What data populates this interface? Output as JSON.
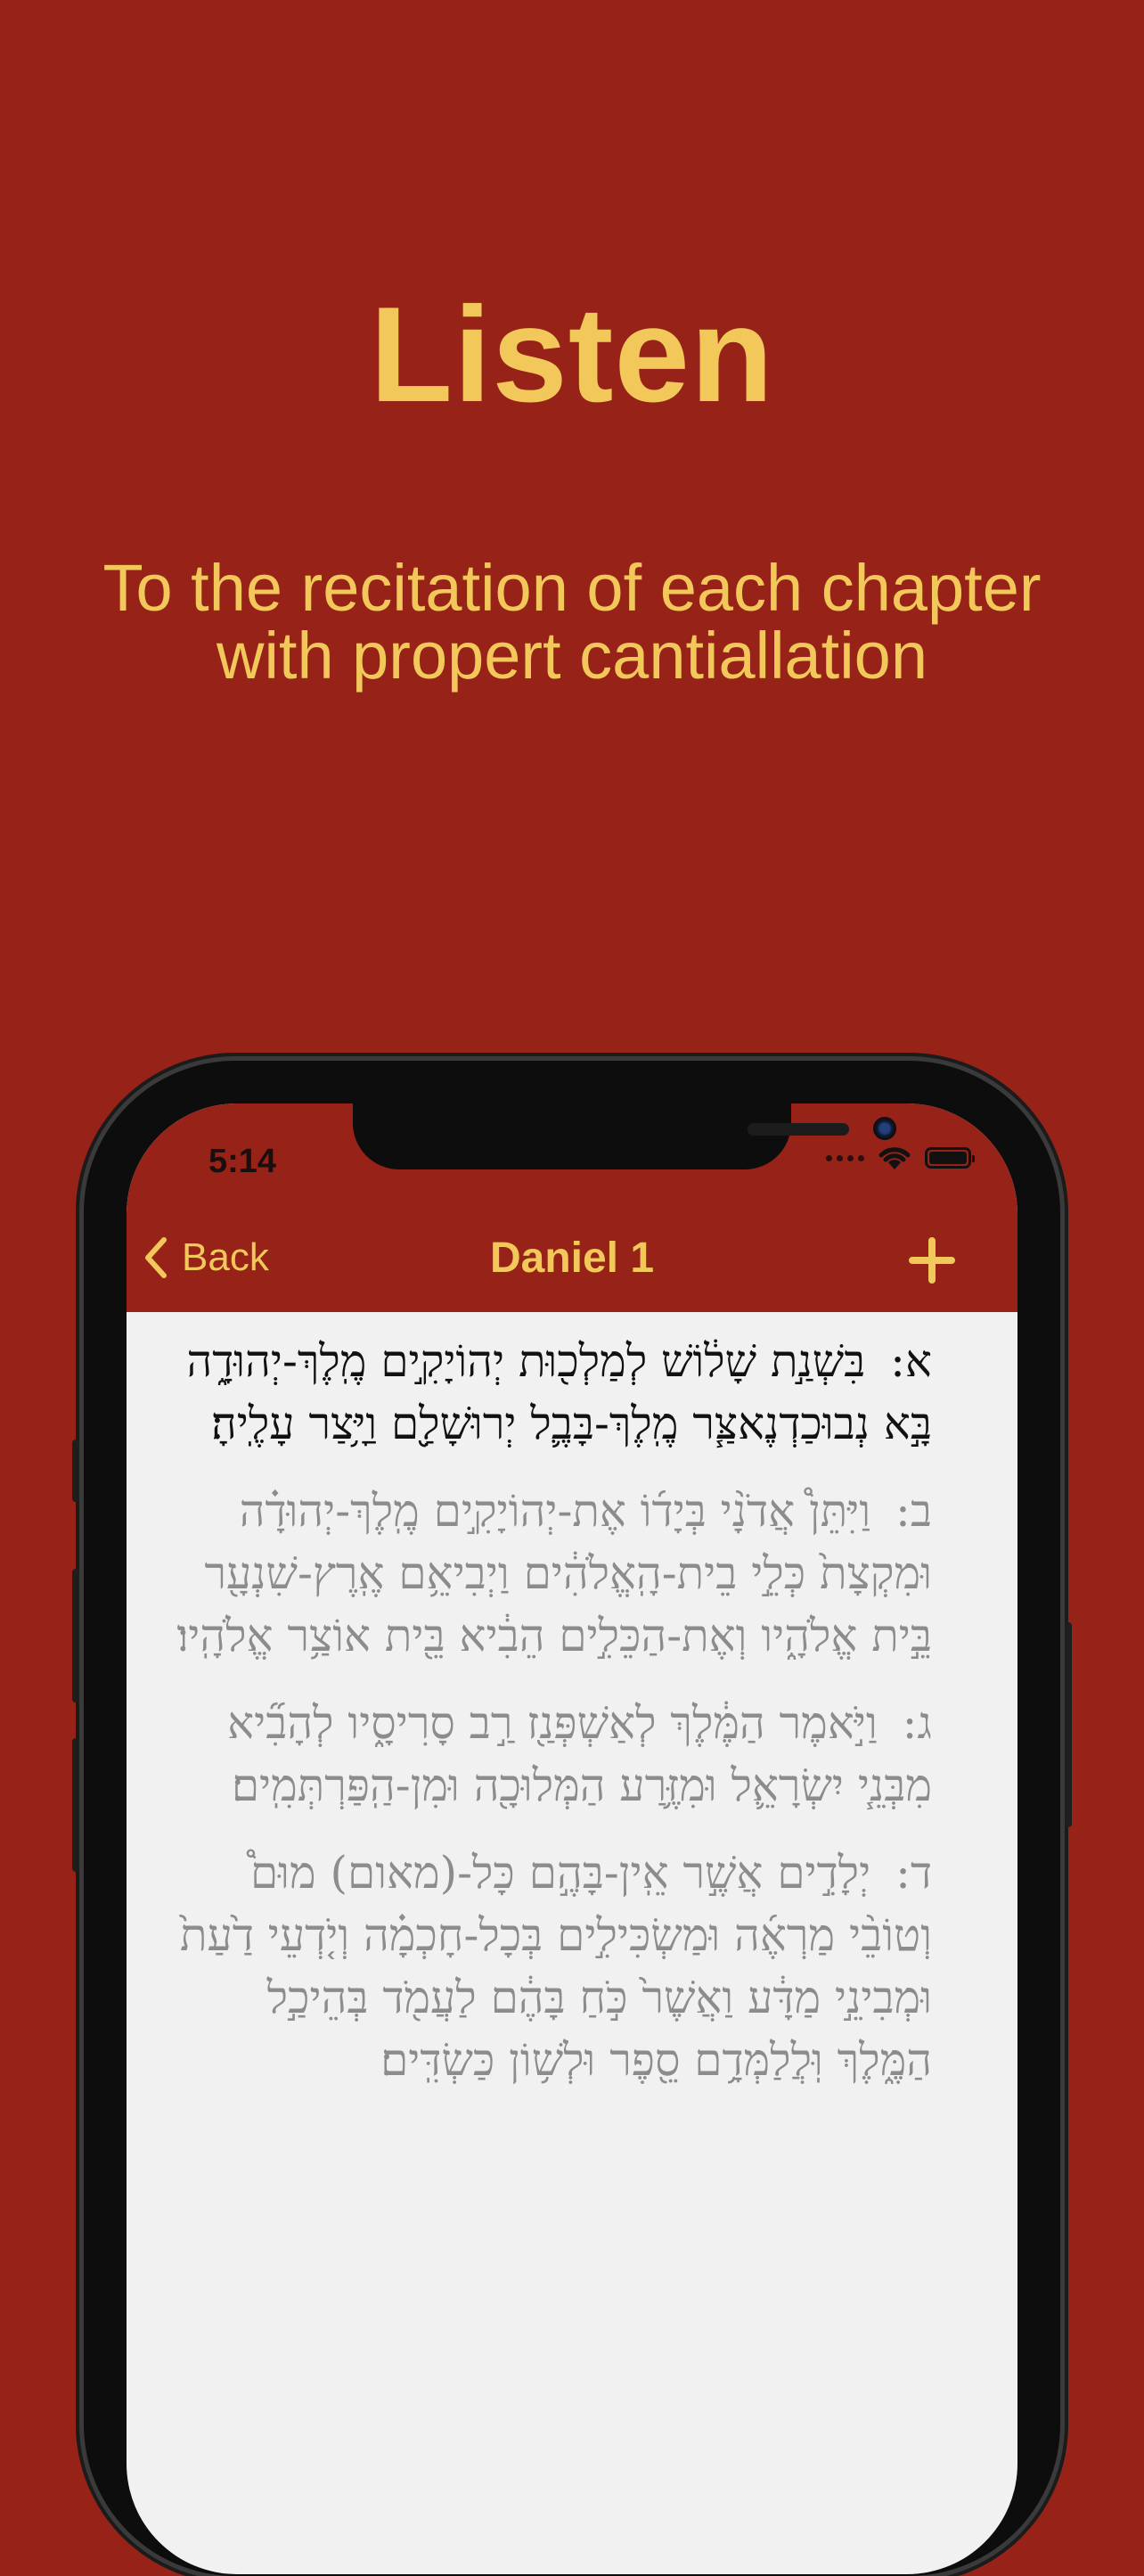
{
  "promo": {
    "headline": "Listen",
    "subhead_line1": "To the recitation of each chapter",
    "subhead_line2": "with propert cantiallation"
  },
  "status_bar": {
    "time": "5:14",
    "icons": [
      "signal-dots-icon",
      "wifi-icon",
      "battery-icon"
    ]
  },
  "nav": {
    "back_label": "Back",
    "title": "Daniel 1",
    "add_icon": "plus-icon"
  },
  "verses": [
    {
      "number": "א:",
      "text": "בִּשְׁנַ֣ת שָׁל֔וֹשׁ לְמַלְכ֖וּת יְהוֹיָקִ֣ים מֶֽלֶךְ-יְהוּדָ֑ה בָּ֣א נְבוּכַדְנֶאצַּ֧ר מֶֽלֶךְ-בָּבֶ֛ל יְרוּשָׁלִַ֖ם וַיָּ֥צַר עָלֶֽיהָ׃",
      "active": true
    },
    {
      "number": "ב:",
      "text": "וַיִּתֵּן֩ אֲדֹנָ֨י בְּיָד֜וֹ אֶת-יְהוֹיָקִ֣ים מֶֽלֶךְ-יְהוּדָ֗ה וּמִקְצָת֙ כְּלֵ֣י בֵית-הָֽאֱלֹהִ֔ים וַיְבִיאֵ֥ם אֶֽרֶץ-שִׁנְעָ֖ר בֵּ֣ית אֱלֹהָ֑יו וְאֶת-הַכֵּלִ֣ים הֵבִ֔יא בֵּ֖ית אוֹצַ֥ר אֱלֹהָֽיו׃",
      "active": false
    },
    {
      "number": "ג:",
      "text": "וַיֹּ֣אמֶר הַמֶּ֔לֶךְ לְאַשְׁפְּנַ֖ז רַ֣ב סָרִיסָ֑יו לְהָבִ֞יא מִבְּנֵ֧י יִשְׂרָאֵ֛ל וּמִזֶּ֥רַע הַמְּלוּכָ֖ה וּמִן-הַֽפַּרְתְּמִֽים׃",
      "active": false
    },
    {
      "number": "ד:",
      "text": "יְלָדִ֣ים אֲשֶׁ֣ר אֵֽין-בָּהֶ֣ם כָּל-(מאום) מוּם֩ וְטוֹבֵ֨י מַרְאֶ֜ה וּמַשְׂכִּילִ֣ים בְּכָל-חָכְמָ֗ה וְיֹ֤דְעֵי דַ֙עַת֙ וּמְבִינֵ֣י מַדָּ֔ע וַאֲשֶׁר֙ כֹּ֣חַ בָּהֶ֔ם לַעֲמֹ֖ד בְּהֵיכַ֣ל הַמֶּ֑לֶךְ וּֽלֲלַמְּדָ֥ם סֵ֖פֶר וּלְשׁ֥וֹן כַּשְׂדִּֽים׃",
      "active": false
    }
  ]
}
